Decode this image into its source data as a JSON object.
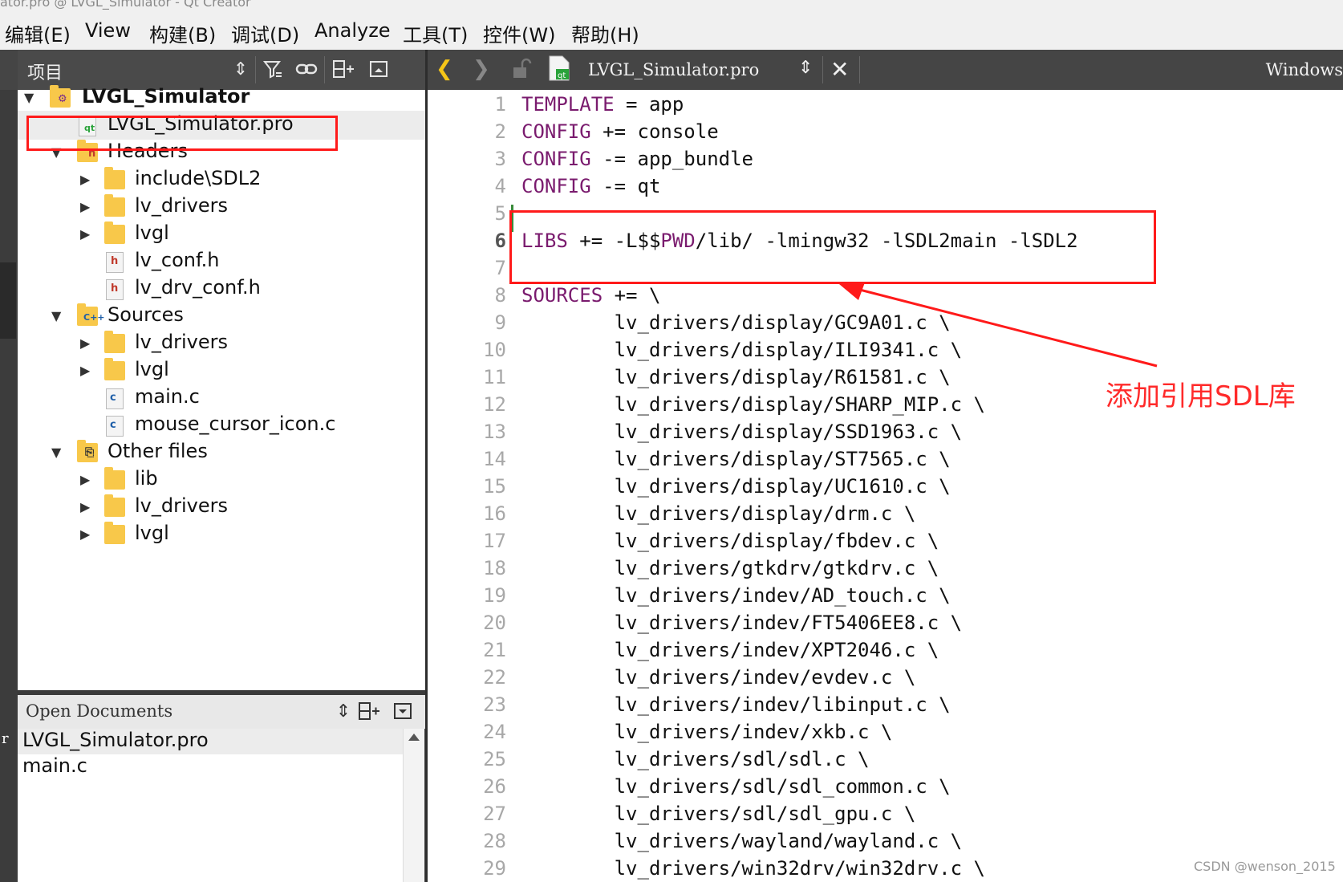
{
  "window": {
    "title": "ator.pro @ LVGL_Simulator - Qt Creator"
  },
  "menu": [
    "编辑(E)",
    "View",
    "构建(B)",
    "调试(D)",
    "Analyze",
    "工具(T)",
    "控件(W)",
    "帮助(H)"
  ],
  "project_panel": {
    "title": "项目",
    "icons": [
      "sort-updown-icon",
      "filter-icon",
      "link-icon",
      "split-add-icon",
      "collapse-icon"
    ]
  },
  "tree": [
    {
      "label": "LVGL_Simulator",
      "type": "project",
      "level": 0,
      "expanded": true
    },
    {
      "label": "LVGL_Simulator.pro",
      "type": "pro-file",
      "level": 1,
      "selected": true
    },
    {
      "label": "Headers",
      "type": "headers-folder",
      "level": 1,
      "expanded": true
    },
    {
      "label": "include\\SDL2",
      "type": "folder",
      "level": 2,
      "expanded": false
    },
    {
      "label": "lv_drivers",
      "type": "folder",
      "level": 2,
      "expanded": false
    },
    {
      "label": "lvgl",
      "type": "folder",
      "level": 2,
      "expanded": false
    },
    {
      "label": "lv_conf.h",
      "type": "h-file",
      "level": 2
    },
    {
      "label": "lv_drv_conf.h",
      "type": "h-file",
      "level": 2
    },
    {
      "label": "Sources",
      "type": "sources-folder",
      "level": 1,
      "expanded": true
    },
    {
      "label": "lv_drivers",
      "type": "folder",
      "level": 2,
      "expanded": false
    },
    {
      "label": "lvgl",
      "type": "folder",
      "level": 2,
      "expanded": false
    },
    {
      "label": "main.c",
      "type": "c-file",
      "level": 2
    },
    {
      "label": "mouse_cursor_icon.c",
      "type": "c-file",
      "level": 2
    },
    {
      "label": "Other files",
      "type": "other-folder",
      "level": 1,
      "expanded": true
    },
    {
      "label": "lib",
      "type": "folder",
      "level": 2,
      "expanded": false
    },
    {
      "label": "lv_drivers",
      "type": "folder",
      "level": 2,
      "expanded": false
    },
    {
      "label": "lvgl",
      "type": "folder",
      "level": 2,
      "expanded": false
    }
  ],
  "open_documents": {
    "title": "Open Documents",
    "items": [
      {
        "label": "LVGL_Simulator.pro",
        "selected": true
      },
      {
        "label": "main.c",
        "selected": false
      }
    ]
  },
  "left_strip_text": "r",
  "editor": {
    "file_name": "LVGL_Simulator.pro",
    "right_label": "Windows",
    "current_line": 6,
    "lines": [
      "TEMPLATE = app",
      "CONFIG += console",
      "CONFIG -= app_bundle",
      "CONFIG -= qt",
      "",
      "LIBS += -L$$PWD/lib/ -lmingw32 -lSDL2main -lSDL2",
      "",
      "SOURCES += \\",
      "        lv_drivers/display/GC9A01.c \\",
      "        lv_drivers/display/ILI9341.c \\",
      "        lv_drivers/display/R61581.c \\",
      "        lv_drivers/display/SHARP_MIP.c \\",
      "        lv_drivers/display/SSD1963.c \\",
      "        lv_drivers/display/ST7565.c \\",
      "        lv_drivers/display/UC1610.c \\",
      "        lv_drivers/display/drm.c \\",
      "        lv_drivers/display/fbdev.c \\",
      "        lv_drivers/gtkdrv/gtkdrv.c \\",
      "        lv_drivers/indev/AD_touch.c \\",
      "        lv_drivers/indev/FT5406EE8.c \\",
      "        lv_drivers/indev/XPT2046.c \\",
      "        lv_drivers/indev/evdev.c \\",
      "        lv_drivers/indev/libinput.c \\",
      "        lv_drivers/indev/xkb.c \\",
      "        lv_drivers/sdl/sdl.c \\",
      "        lv_drivers/sdl/sdl_common.c \\",
      "        lv_drivers/sdl/sdl_gpu.c \\",
      "        lv_drivers/wayland/wayland.c \\",
      "        lv_drivers/win32drv/win32drv.c \\"
    ],
    "keywords": [
      "TEMPLATE",
      "CONFIG",
      "LIBS",
      "SOURCES",
      "PWD"
    ]
  },
  "annotation": {
    "text": "添加引用SDL库",
    "color": "#ff2a2a"
  },
  "watermark": "CSDN @wenson_2015",
  "colors": {
    "highlight_box": "#ff1a1a",
    "keyword": "#7a1b6e",
    "panel_dark": "#454545"
  }
}
